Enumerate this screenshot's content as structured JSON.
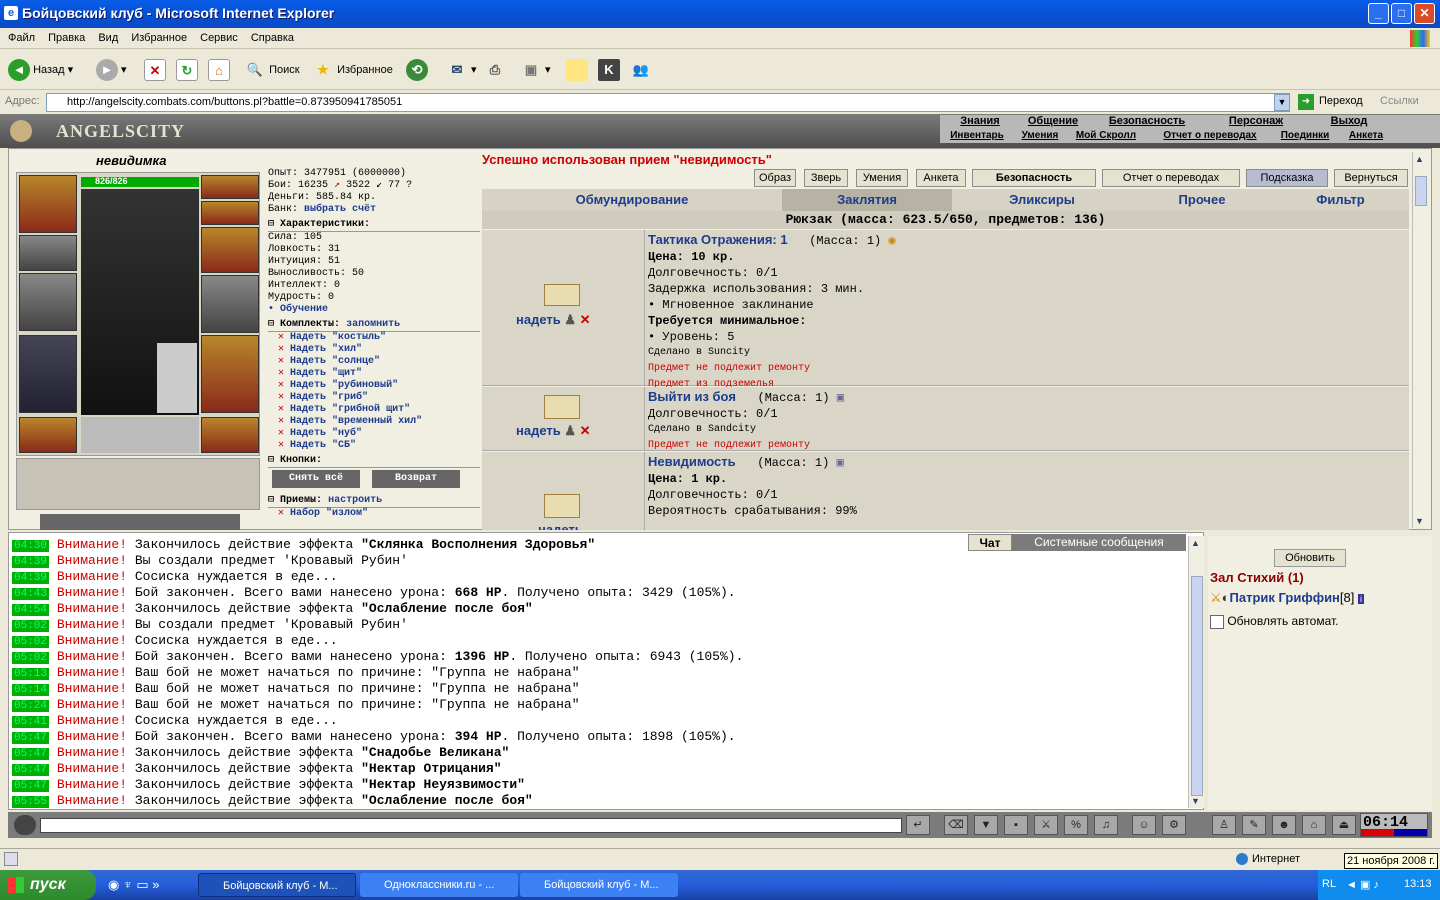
{
  "window": {
    "title": "Бойцовский клуб - Microsoft Internet Explorer"
  },
  "menu": [
    "Файл",
    "Правка",
    "Вид",
    "Избранное",
    "Сервис",
    "Справка"
  ],
  "toolbar": {
    "back": "Назад",
    "search": "Поиск",
    "favorites": "Избранное"
  },
  "address": {
    "label": "Адрес:",
    "url": "http://angelscity.combats.com/buttons.pl?battle=0.873950941785051",
    "go": "Переход",
    "links": "Ссылки"
  },
  "game_header": {
    "logo": "ANGELSCITY",
    "top_links": [
      "Знания",
      "Общение",
      "Безопасность",
      "Персонаж",
      "Выход"
    ],
    "bottom_links": [
      "Инвентарь",
      "Умения",
      "Мой Скролл",
      "Отчет о переводах",
      "Поединки",
      "Анкета"
    ]
  },
  "character": {
    "name": "невидимка",
    "hp": "826/826"
  },
  "stats": {
    "exp": "Опыт: 3477951 (6000000)",
    "fights": "Бои:   16235",
    "wins": "3522",
    "draws": "77",
    "money": "Деньги: 585.84 кр.",
    "bank_label": "Банк:",
    "bank_link": "выбрать счёт",
    "chars_title": "Характеристики:",
    "strength": "Сила: 105",
    "agility": "Ловкость: 31",
    "intuition": "Интуиция: 51",
    "endurance": "Выносливость: 50",
    "intellect": "Интеллект: 0",
    "wisdom": "Мудрость: 0",
    "training": "• Обучение",
    "sets_title": "Комплекты:",
    "sets_remember": "запомнить",
    "sets": [
      "Надеть \"костыль\"",
      "Надеть \"хил\"",
      "Надеть \"солнце\"",
      "Надеть \"щит\"",
      "Надеть \"рубиновый\"",
      "Надеть \"гриб\"",
      "Надеть \"грибной щит\"",
      "Надеть \"временный хил\"",
      "Надеть \"нуб\"",
      "Надеть \"СБ\""
    ],
    "buttons_title": "Кнопки:",
    "take_off_all": "Снять всё",
    "return": "Возврат",
    "tricks_title": "Приемы:",
    "tricks_config": "настроить",
    "trick": "Набор \"излом\""
  },
  "content": {
    "success": "Успешно использован прием \"невидимость\"",
    "nav": [
      "Образ",
      "Зверь",
      "Умения",
      "Анкета",
      "Безопасность",
      "Отчет о переводах",
      "Подсказка",
      "Вернуться"
    ],
    "tabs": [
      "Обмундирование",
      "Заклятия",
      "Эликсиры",
      "Прочее",
      "Фильтр"
    ],
    "backpack": "Рюкзак (масса: 623.5/650, предметов: 136)",
    "items": [
      {
        "name": "Тактика Отражения: 1",
        "mass": "(Масса: 1)",
        "price": "Цена: 10 кр.",
        "lines": [
          "Долговечность: 0/1",
          "Задержка использования: 3 мин.",
          "• Мгновенное заклинание"
        ],
        "req_title": "Требуется минимальное:",
        "req": "• Уровень: 5",
        "made": "Сделано в Suncity",
        "red": [
          "Предмет не подлежит ремонту",
          "Предмет из подземелья"
        ],
        "action": "надеть"
      },
      {
        "name": "Выйти из боя",
        "mass": "(Масса: 1)",
        "lines": [
          "Долговечность: 0/1"
        ],
        "made": "Сделано в Sandcity",
        "red": [
          "Предмет не подлежит ремонту"
        ],
        "action": "надеть"
      },
      {
        "name": "Невидимость",
        "mass": "(Масса: 1)",
        "price": "Цена: 1 кр.",
        "lines": [
          "Долговечность: 0/1",
          "Вероятность срабатывания: 99%"
        ],
        "action": "надеть"
      }
    ]
  },
  "chat": {
    "tabs": [
      "Чат",
      "Системные сообщения"
    ],
    "lines": [
      {
        "t": "04:30",
        "w": "Внимание!",
        "m": "Закончилось действие эффекта ",
        "b": "\"Склянка Восполнения Здоровья\"",
        "e": ""
      },
      {
        "t": "04:39",
        "w": "Внимание!",
        "m": "Вы создали предмет 'Кровавый Рубин'",
        "b": "",
        "e": ""
      },
      {
        "t": "04:39",
        "w": "Внимание!",
        "m": "Сосиска нуждается в еде...",
        "b": "",
        "e": ""
      },
      {
        "t": "04:43",
        "w": "Внимание!",
        "m": "Бой закончен. Всего вами нанесено урона: ",
        "b": "668 HP",
        "e": ". Получено опыта: 3429 (105%)."
      },
      {
        "t": "04:54",
        "w": "Внимание!",
        "m": "Закончилось действие эффекта ",
        "b": "\"Ослабление после боя\"",
        "e": ""
      },
      {
        "t": "05:02",
        "w": "Внимание!",
        "m": "Вы создали предмет 'Кровавый Рубин'",
        "b": "",
        "e": ""
      },
      {
        "t": "05:02",
        "w": "Внимание!",
        "m": "Сосиска нуждается в еде...",
        "b": "",
        "e": ""
      },
      {
        "t": "05:02",
        "w": "Внимание!",
        "m": "Бой закончен. Всего вами нанесено урона: ",
        "b": "1396 HP",
        "e": ". Получено опыта: 6943 (105%)."
      },
      {
        "t": "05:13",
        "w": "Внимание!",
        "m": "Ваш бой не может начаться по причине: \"Группа не набрана\"",
        "b": "",
        "e": ""
      },
      {
        "t": "05:14",
        "w": "Внимание!",
        "m": "Ваш бой не может начаться по причине: \"Группа не набрана\"",
        "b": "",
        "e": ""
      },
      {
        "t": "05:24",
        "w": "Внимание!",
        "m": "Ваш бой не может начаться по причине: \"Группа не набрана\"",
        "b": "",
        "e": ""
      },
      {
        "t": "05:41",
        "w": "Внимание!",
        "m": "Сосиска нуждается в еде...",
        "b": "",
        "e": ""
      },
      {
        "t": "05:47",
        "w": "Внимание!",
        "m": "Бой закончен. Всего вами нанесено урона: ",
        "b": "394 HP",
        "e": ". Получено опыта: 1898 (105%)."
      },
      {
        "t": "05:47",
        "w": "Внимание!",
        "m": "Закончилось действие эффекта ",
        "b": "\"Снадобье Великана\"",
        "e": ""
      },
      {
        "t": "05:47",
        "w": "Внимание!",
        "m": "Закончилось действие эффекта ",
        "b": "\"Нектар Отрицания\"",
        "e": ""
      },
      {
        "t": "05:47",
        "w": "Внимание!",
        "m": "Закончилось действие эффекта ",
        "b": "\"Нектар Неуязвимости\"",
        "e": ""
      },
      {
        "t": "05:55",
        "w": "Внимание!",
        "m": "Закончилось действие эффекта ",
        "b": "\"Ослабление после боя\"",
        "e": ""
      }
    ]
  },
  "side": {
    "refresh": "Обновить",
    "room": "Зал Стихий (1)",
    "player": "Патрик Гриффин",
    "level": "[8]",
    "auto": "Обновлять автомат."
  },
  "inputbar": {
    "clock": "06:14"
  },
  "statusbar": {
    "zone": "Интернет",
    "date": "21 ноября 2008 г."
  },
  "taskbar": {
    "start": "пуск",
    "tasks": [
      "Бойцовский клуб - M...",
      "Одноклассники.ru - ...",
      "Бойцовский клуб - M..."
    ],
    "lang": "RL",
    "time": "13:13"
  }
}
